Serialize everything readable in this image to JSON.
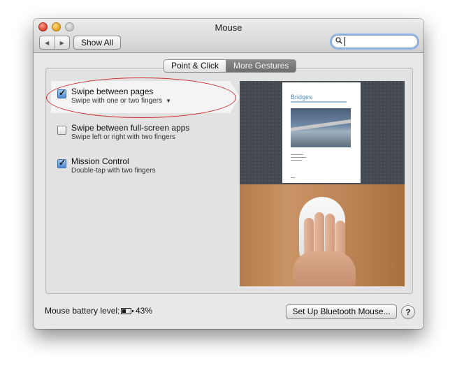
{
  "window": {
    "title": "Mouse"
  },
  "toolbar": {
    "back_glyph": "◀",
    "forward_glyph": "▶",
    "show_all_label": "Show All",
    "search": {
      "value": "",
      "icon": "search-icon"
    }
  },
  "tabs": [
    {
      "label": "Point & Click",
      "active": false
    },
    {
      "label": "More Gestures",
      "active": true
    }
  ],
  "gestures": [
    {
      "title": "Swipe between pages",
      "subtitle": "Swipe with one or two fingers",
      "checked": true,
      "has_menu": true,
      "selected": true
    },
    {
      "title": "Swipe between full-screen apps",
      "subtitle": "Swipe left or right with two fingers",
      "checked": false,
      "has_menu": false,
      "selected": false
    },
    {
      "title": "Mission Control",
      "subtitle": "Double-tap with two fingers",
      "checked": true,
      "has_menu": false,
      "selected": false
    }
  ],
  "preview": {
    "doc_title": "Bridges"
  },
  "footer": {
    "battery_label": "Mouse battery level:",
    "battery_value": "43%",
    "battery_fraction": 0.43,
    "bluetooth_button": "Set Up Bluetooth Mouse...",
    "help_glyph": "?"
  },
  "colors": {
    "accent": "#4a86d1",
    "highlight_oval": "#d0282a",
    "active_tab": "#7a7a7a"
  }
}
